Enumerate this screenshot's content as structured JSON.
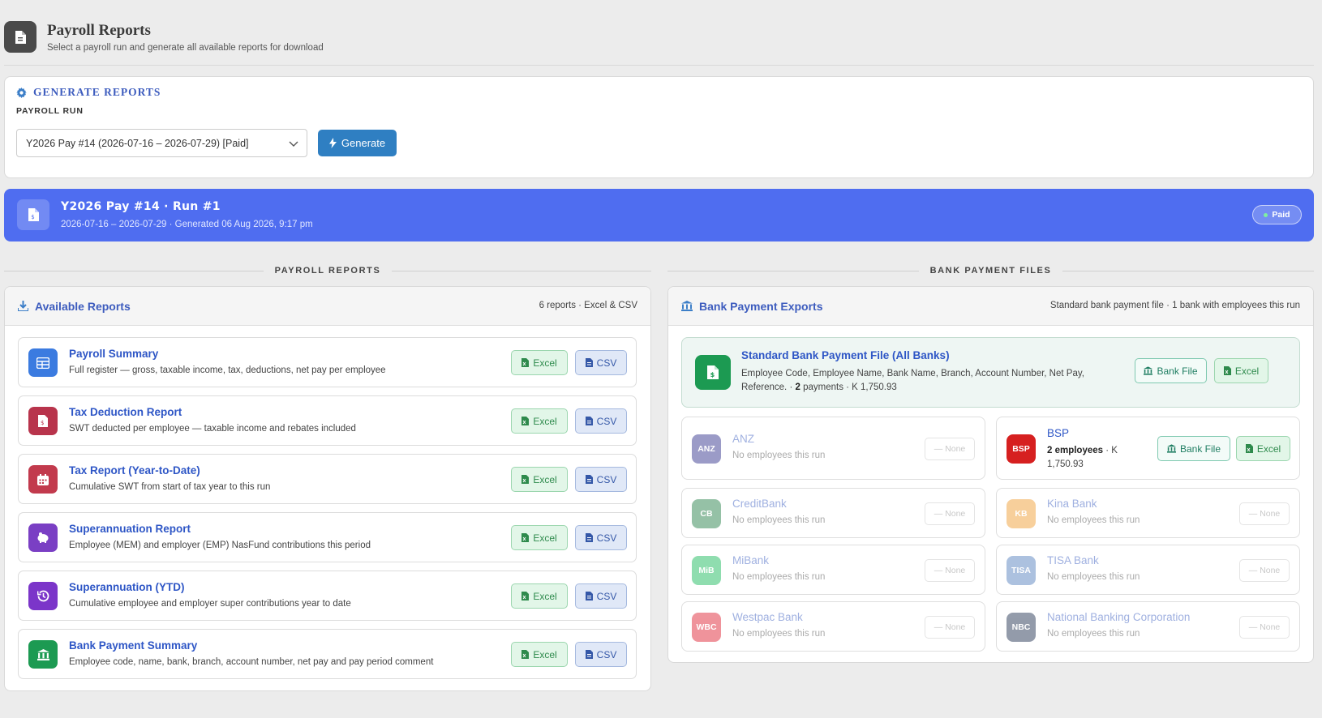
{
  "header": {
    "title": "Payroll Reports",
    "subtitle": "Select a payroll run and generate all available reports for download"
  },
  "generate": {
    "title": "GENERATE REPORTS",
    "run_label": "PAYROLL RUN",
    "selected_run": "Y2026 Pay #14  (2026-07-16 – 2026-07-29)  [Paid]",
    "button_label": "Generate"
  },
  "banner": {
    "title": "Y2026 Pay #14  ·  Run #1",
    "subtitle": "2026-07-16 – 2026-07-29  ·  Generated 06 Aug 2026, 9:17 pm",
    "status": "Paid"
  },
  "sections": {
    "payroll_reports": "PAYROLL REPORTS",
    "bank_payment_files": "BANK PAYMENT FILES"
  },
  "reports_panel": {
    "title": "Available Reports",
    "meta": "6 reports  ·  Excel & CSV",
    "excel_label": "Excel",
    "csv_label": "CSV",
    "items": [
      {
        "name": "Payroll Summary",
        "desc": "Full register — gross, taxable income, tax, deductions, net pay per employee",
        "color": "#3b7be0"
      },
      {
        "name": "Tax Deduction Report",
        "desc": "SWT deducted per employee — taxable income and rebates included",
        "color": "#b8344c"
      },
      {
        "name": "Tax Report (Year-to-Date)",
        "desc": "Cumulative SWT from start of tax year to this run",
        "color": "#c23a4d"
      },
      {
        "name": "Superannuation Report",
        "desc": "Employee (MEM) and employer (EMP) NasFund contributions this period",
        "color": "#7a3fc4"
      },
      {
        "name": "Superannuation (YTD)",
        "desc": "Cumulative employee and employer super contributions year to date",
        "color": "#7b35c9"
      },
      {
        "name": "Bank Payment Summary",
        "desc": "Employee code, name, bank, branch, account number, net pay and pay period comment",
        "color": "#1c9a52"
      }
    ]
  },
  "bank_panel": {
    "title": "Bank Payment Exports",
    "meta": "Standard bank payment file  ·  1 bank with employees this run",
    "bank_file_label": "Bank File",
    "excel_label": "Excel",
    "none_label": "— None",
    "standard": {
      "name": "Standard Bank Payment File (All Banks)",
      "desc_prefix": "Employee Code, Employee Name, Bank Name, Branch, Account Number, Net Pay, Reference.  ·  ",
      "payments_count": "2",
      "desc_suffix": " payments  ·  K 1,750.93"
    },
    "banks": [
      {
        "badge": "ANZ",
        "name": "ANZ",
        "sub": "No employees this run",
        "color": "#4a4a9a",
        "active": false
      },
      {
        "badge": "BSP",
        "name": "BSP",
        "employees": "2 employees",
        "amount": "  ·  K 1,750.93",
        "color": "#d62020",
        "active": true
      },
      {
        "badge": "CB",
        "name": "CreditBank",
        "sub": "No employees this run",
        "color": "#3f8f5e",
        "active": false
      },
      {
        "badge": "KB",
        "name": "Kina Bank",
        "sub": "No employees this run",
        "color": "#f2a94a",
        "active": false
      },
      {
        "badge": "MiB",
        "name": "MiBank",
        "sub": "No employees this run",
        "color": "#35c26f",
        "active": false
      },
      {
        "badge": "TISA",
        "name": "TISA Bank",
        "sub": "No employees this run",
        "color": "#6a8fc6",
        "active": false
      },
      {
        "badge": "WBC",
        "name": "Westpac Bank",
        "sub": "No employees this run",
        "color": "#e23c4a",
        "active": false
      },
      {
        "badge": "NBC",
        "name": "National Banking Corporation",
        "sub": "No employees this run",
        "color": "#3c4a66",
        "active": false
      }
    ]
  }
}
